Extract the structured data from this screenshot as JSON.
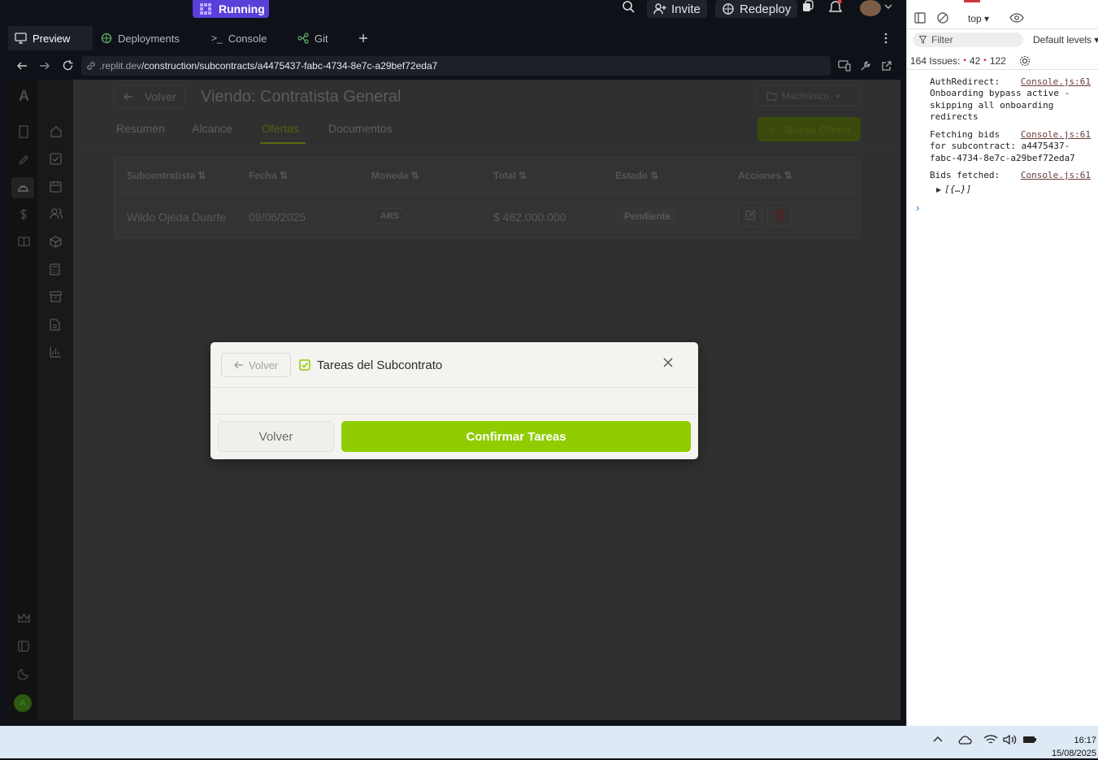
{
  "topbar": {
    "run_label": "Running",
    "invite_label": "Invite",
    "redeploy_label": "Redeploy"
  },
  "tabs": [
    {
      "label": "Preview",
      "icon": "monitor-icon",
      "active": true
    },
    {
      "label": "Deployments",
      "icon": "deploy-icon",
      "active": false
    },
    {
      "label": "Console",
      "icon": "terminal-icon",
      "active": false
    },
    {
      "label": "Git",
      "icon": "git-icon",
      "active": false
    }
  ],
  "urlbar": {
    "host": ".replit.dev",
    "path": "/construction/subcontracts/a4475437-fabc-4734-8e7c-a29bef72eda7"
  },
  "app": {
    "rail_letter": "A",
    "avatar_letter": "A",
    "back_label": "Volver",
    "page_title": "Viendo: Contratista General",
    "project_select": "Machónico",
    "tabs": [
      "Resumen",
      "Alcance",
      "Ofertas",
      "Documentos"
    ],
    "active_tab": "Ofertas",
    "new_bid_label": "Nueva Oferta",
    "table": {
      "headers": [
        "Subcontratista",
        "Fecha",
        "Moneda",
        "Total",
        "Estado",
        "Acciones"
      ],
      "rows": [
        {
          "subcontratista": "Wildo Ojeda Duarte",
          "fecha": "09/06/2025",
          "moneda": "ARS",
          "total": "$ 462.000.000",
          "estado": "Pendiente"
        }
      ]
    }
  },
  "modal": {
    "back_label": "Volver",
    "title": "Tareas del Subcontrato",
    "cancel_label": "Volver",
    "confirm_label": "Confirmar Tareas",
    "confirm_color": "#8fcc00"
  },
  "devtools": {
    "context": "top",
    "filter_placeholder": "Filter",
    "levels": "Default levels",
    "issues_label": "164 Issues:",
    "errors_count": "42",
    "warnings_count": "122",
    "logs": [
      {
        "text": "AuthRedirect:\nOnboarding bypass active -\nskipping all onboarding\nredirects",
        "source": "Console.js:61"
      },
      {
        "text": "Fetching bids\nfor subcontract: a4475437-\nfabc-4734-8e7c-a29bef72eda7",
        "source": "Console.js:61"
      },
      {
        "text": "Bids fetched:",
        "source": "Console.js:61"
      }
    ],
    "object_preview": "[{…}]"
  },
  "taskbar": {
    "time": "16:17",
    "date": "15/08/2025"
  }
}
